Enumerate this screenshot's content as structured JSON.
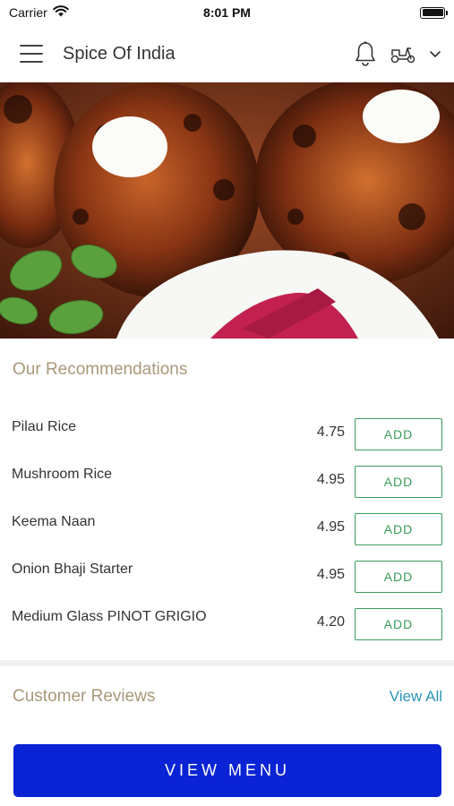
{
  "status_bar": {
    "carrier": "Carrier",
    "time": "8:01 PM"
  },
  "header": {
    "title": "Spice Of India",
    "icons": [
      "menu-icon",
      "bell-icon",
      "scooter-icon",
      "chevron-down-icon"
    ]
  },
  "recommendations": {
    "title": "Our Recommendations",
    "items": [
      {
        "name": "Pilau Rice",
        "price": "4.75",
        "add_label": "ADD"
      },
      {
        "name": "Mushroom Rice",
        "price": "4.95",
        "add_label": "ADD"
      },
      {
        "name": "Keema Naan",
        "price": "4.95",
        "add_label": "ADD"
      },
      {
        "name": "Onion Bhaji Starter",
        "price": "4.95",
        "add_label": "ADD"
      },
      {
        "name": "Medium Glass PINOT GRIGIO",
        "price": "4.20",
        "add_label": "ADD"
      }
    ]
  },
  "reviews": {
    "title": "Customer Reviews",
    "view_all_label": "View All"
  },
  "footer": {
    "view_menu_label": "VIEW MENU"
  },
  "colors": {
    "primary_button": "#0a23d4",
    "add_button": "#3a9c5a",
    "section_title": "#a9987a",
    "link": "#2a96b8"
  }
}
